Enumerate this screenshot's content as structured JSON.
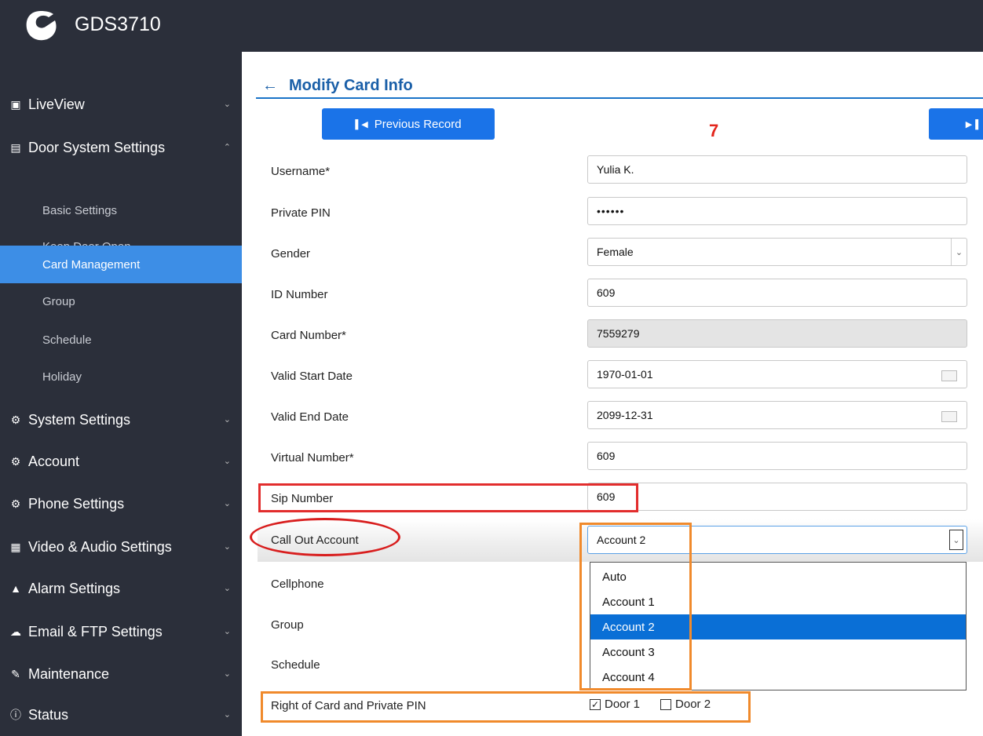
{
  "app": {
    "title": "GDS3710"
  },
  "sidebar": {
    "items": [
      {
        "label": "LiveView",
        "icon": "video-icon",
        "glyph": "▣"
      },
      {
        "label": "Door System Settings",
        "icon": "door-panel-icon",
        "glyph": "▤"
      },
      {
        "label": "System Settings",
        "icon": "settings-icon",
        "glyph": "⚙"
      },
      {
        "label": "Account",
        "icon": "account-icon",
        "glyph": "⚙"
      },
      {
        "label": "Phone Settings",
        "icon": "phone-settings-icon",
        "glyph": "⚙"
      },
      {
        "label": "Video & Audio Settings",
        "icon": "video-audio-icon",
        "glyph": "▦"
      },
      {
        "label": "Alarm Settings",
        "icon": "bell-icon",
        "glyph": "▲"
      },
      {
        "label": "Email & FTP Settings",
        "icon": "cloud-icon",
        "glyph": "☁"
      },
      {
        "label": "Maintenance",
        "icon": "wrench-icon",
        "glyph": "✎"
      },
      {
        "label": "Status",
        "icon": "info-icon",
        "glyph": "ⓘ"
      }
    ],
    "sub_items": [
      {
        "label": "Basic Settings"
      },
      {
        "label": "Keep Door Open"
      },
      {
        "label": "Card Management",
        "active": true
      },
      {
        "label": "Group"
      },
      {
        "label": "Schedule"
      },
      {
        "label": "Holiday"
      }
    ]
  },
  "main": {
    "title": "Modify Card Info",
    "previous_label": "Previous Record",
    "record_number": "7",
    "fields": {
      "username": {
        "label": "Username*",
        "value": "Yulia K."
      },
      "private_pin": {
        "label": "Private PIN",
        "value": "••••••"
      },
      "gender": {
        "label": "Gender",
        "value": "Female"
      },
      "id_number": {
        "label": "ID Number",
        "value": "609"
      },
      "card_number": {
        "label": "Card Number*",
        "value": "7559279"
      },
      "valid_start": {
        "label": "Valid Start Date",
        "value": "1970-01-01"
      },
      "valid_end": {
        "label": "Valid End Date",
        "value": "2099-12-31"
      },
      "virtual_number": {
        "label": "Virtual Number*",
        "value": "609"
      },
      "sip_number": {
        "label": "Sip Number",
        "value": "609"
      },
      "call_out_account": {
        "label": "Call Out Account",
        "value": "Account 2"
      },
      "cellphone": {
        "label": "Cellphone"
      },
      "group": {
        "label": "Group"
      },
      "schedule": {
        "label": "Schedule"
      },
      "rights": {
        "label": "Right of Card and Private PIN"
      }
    },
    "call_out_options": [
      "Auto",
      "Account 1",
      "Account 2",
      "Account 3",
      "Account 4"
    ],
    "call_out_selected": "Account 2",
    "doors": [
      {
        "label": "Door 1",
        "checked": true
      },
      {
        "label": "Door 2",
        "checked": false
      }
    ]
  },
  "colors": {
    "sidebar_bg": "#2b2f3a",
    "active_item": "#3d8ee6",
    "button_blue": "#1a73e8",
    "title_blue": "#1a5fa8",
    "annotation_red": "#e22d2d",
    "annotation_orange": "#f08a2c",
    "record_number_red": "#e3261c"
  }
}
